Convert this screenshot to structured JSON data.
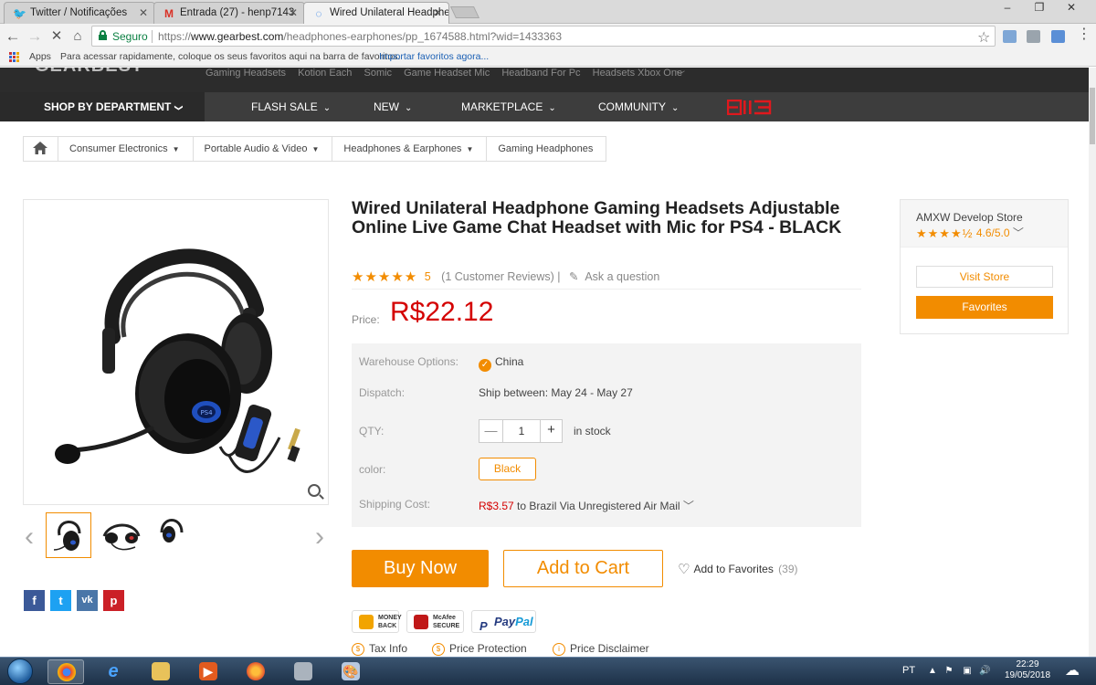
{
  "browser": {
    "tabs": [
      {
        "title": "Twitter / Notificações"
      },
      {
        "title": "Entrada (27) - henp7143"
      },
      {
        "title": "Wired Unilateral Headphe"
      }
    ],
    "secure_label": "Seguro",
    "url_scheme": "https://",
    "url_host": "www.gearbest.com",
    "url_path": "/headphones-earphones/pp_1674588.html?wid=1433363",
    "bookmarks": {
      "apps_label": "Apps",
      "hint": "Para acessar rapidamente, coloque os seus favoritos aqui na barra de favoritos.",
      "import_link": "Importar favoritos agora..."
    }
  },
  "site": {
    "hot_links": [
      "Gaming Headsets",
      "Kotion Each",
      "Somic",
      "Game Headset Mic",
      "Headband For Pc",
      "Headsets Xbox One"
    ],
    "nav": {
      "shop_by_department": "SHOP BY DEPARTMENT",
      "items": [
        "FLASH SALE",
        "NEW",
        "MARKETPLACE",
        "COMMUNITY"
      ]
    },
    "breadcrumb": [
      "Consumer Electronics",
      "Portable Audio & Video",
      "Headphones & Earphones",
      "Gaming Headphones"
    ]
  },
  "product": {
    "title": "Wired Unilateral Headphone Gaming Headsets Adjustable Online Live Game Chat Headset with Mic for PS4 - BLACK",
    "rating_value": 5,
    "rating_count": "5",
    "reviews_text": "(1 Customer Reviews)",
    "separator": "|",
    "ask_question": "Ask a question",
    "price_label": "Price:",
    "price": "R$22.12",
    "options": {
      "warehouse_label": "Warehouse Options:",
      "warehouse_value": "China",
      "dispatch_label": "Dispatch:",
      "dispatch_value": "Ship between: May 24 - May 27",
      "qty_label": "QTY:",
      "qty_value": "1",
      "stock": "in stock",
      "color_label": "color:",
      "color_value": "Black",
      "shipping_label": "Shipping Cost:",
      "shipping_price": "R$3.57",
      "shipping_text": " to Brazil Via Unregistered Air Mail"
    },
    "buy_now": "Buy Now",
    "add_to_cart": "Add to Cart",
    "add_to_favorites": "Add to Favorites",
    "favorites_count": "(39)",
    "badges": {
      "money_back_1": "MONEY",
      "money_back_2": "BACK",
      "mcafee_1": "McAfee",
      "mcafee_2": "SECURE",
      "paypal_1": "Pay",
      "paypal_2": "Pal"
    },
    "links": [
      "Tax Info",
      "Price Protection",
      "Price Disclaimer"
    ]
  },
  "store": {
    "name": "AMXW Develop Store",
    "rating_value": 4.6,
    "rating": "4.6/5.0",
    "visit": "Visit Store",
    "favorites": "Favorites"
  },
  "social": [
    "f",
    "t",
    "vk",
    "p"
  ],
  "taskbar": {
    "lang": "PT",
    "time": "22:29",
    "date": "19/05/2018"
  },
  "colors": {
    "accent": "#f28c00",
    "price": "#d40000",
    "nav_bg": "#3d3d3d"
  }
}
